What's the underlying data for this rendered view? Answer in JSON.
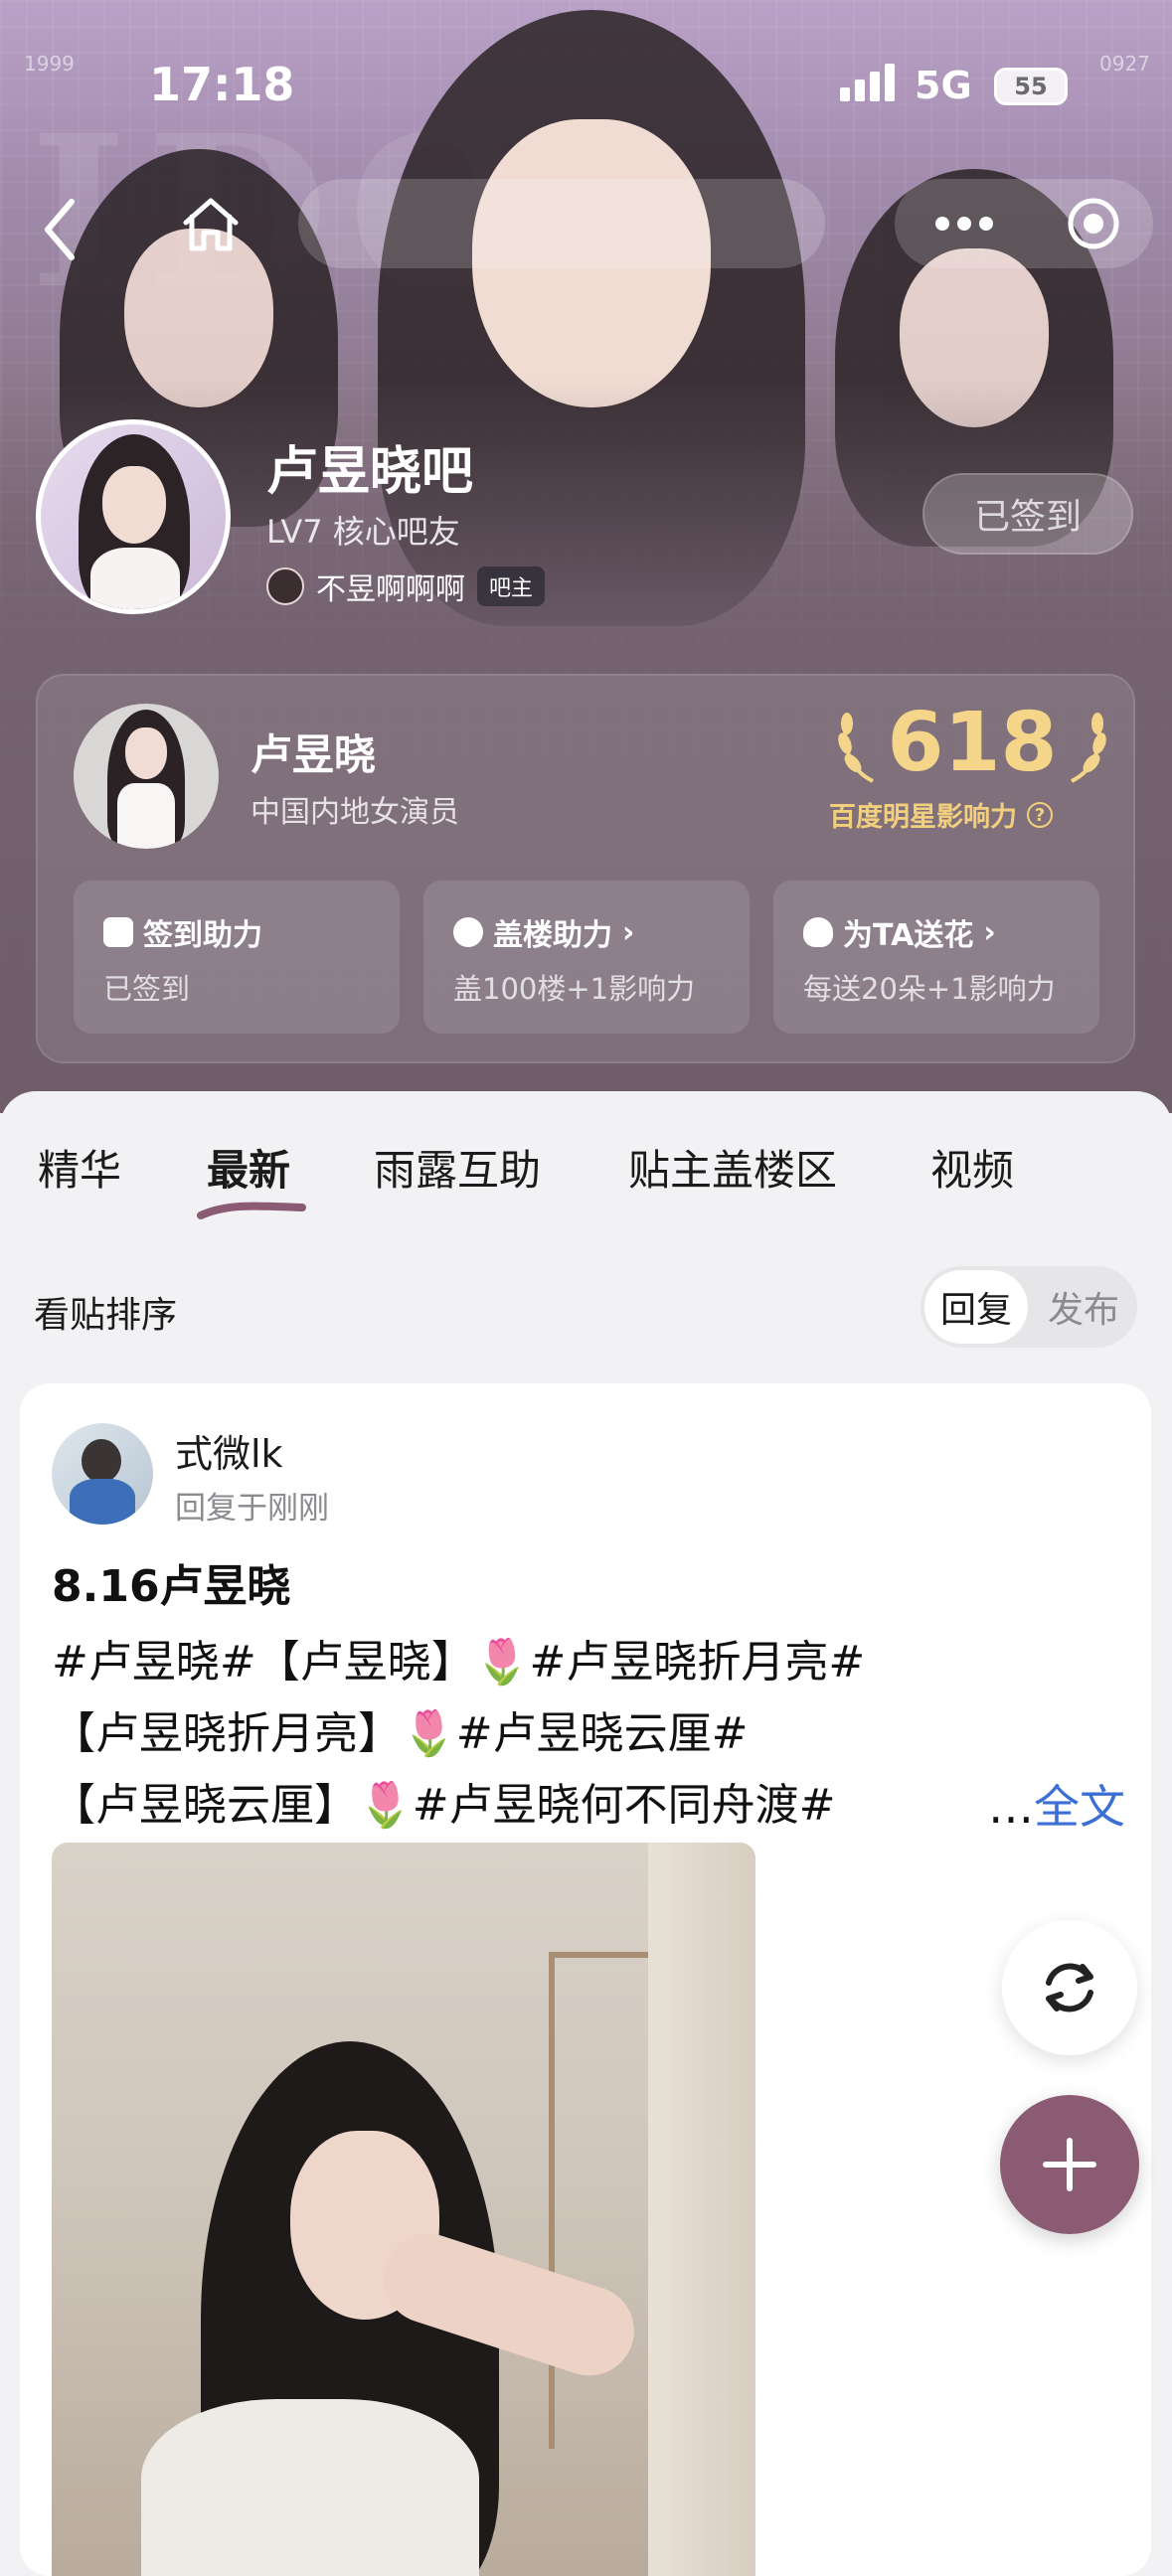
{
  "status_bar": {
    "time": "17:18",
    "network": "5G",
    "battery": "55"
  },
  "banner": {
    "deco_text": "IDOL",
    "corner_left": "1999",
    "corner_right": "0927"
  },
  "forum": {
    "name": "卢昱晓吧",
    "level": "LV7 核心吧友",
    "owner_name": "不昱啊啊啊",
    "owner_tag": "吧主",
    "signed_label": "已签到"
  },
  "star_card": {
    "name": "卢昱晓",
    "description": "中国内地女演员",
    "score": "618",
    "score_label": "百度明星影响力",
    "actions": [
      {
        "title": "签到助力",
        "desc": "已签到",
        "chevron": ""
      },
      {
        "title": "盖楼助力",
        "desc": "盖100楼+1影响力",
        "chevron": "›"
      },
      {
        "title": "为TA送花",
        "desc": "每送20朵+1影响力",
        "chevron": "›"
      }
    ]
  },
  "tabs": [
    "精华",
    "最新",
    "雨露互助",
    "贴主盖楼区",
    "视频"
  ],
  "active_tab": "最新",
  "sort": {
    "label": "看贴排序",
    "options": [
      "回复",
      "发布"
    ],
    "selected": "回复"
  },
  "post": {
    "user": "式微lk",
    "time": "回复于刚刚",
    "title": "8.16卢昱晓",
    "lines": [
      "#卢昱晓#【卢昱晓】🌷#卢昱晓折月亮#",
      "【卢昱晓折月亮】🌷#卢昱晓云厘#",
      "【卢昱晓云厘】🌷#卢昱晓何不同舟渡#"
    ],
    "more_dots": "…",
    "more_label": "全文"
  },
  "colors": {
    "accent": "#8b5a73",
    "link": "#3c6fd6",
    "gold": "#f4d589"
  }
}
